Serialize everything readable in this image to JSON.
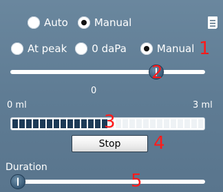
{
  "mode": {
    "options": [
      {
        "label": "Auto",
        "checked": false
      },
      {
        "label": "Manual",
        "checked": true
      }
    ]
  },
  "pressure": {
    "options": [
      {
        "label": "At peak",
        "checked": false
      },
      {
        "label": "0 daPa",
        "checked": false
      },
      {
        "label": "Manual",
        "checked": true
      }
    ]
  },
  "pressure_slider": {
    "level": 0.77
  },
  "volume_scale": {
    "min_label": "0 ml",
    "mid_label": "0",
    "max_label": "3 ml"
  },
  "volume_progress": {
    "level": 0.49
  },
  "stop_button": {
    "label": "Stop"
  },
  "duration": {
    "label": "Duration",
    "level": 0.0
  },
  "callouts": [
    "1",
    "2",
    "3",
    "4",
    "5"
  ],
  "colors": {
    "panel": "#607f98",
    "callout": "#ff1a1a",
    "progress_fill": "#1c3a56",
    "thumb": "#385a77"
  },
  "icons": {
    "note": "note-icon"
  }
}
